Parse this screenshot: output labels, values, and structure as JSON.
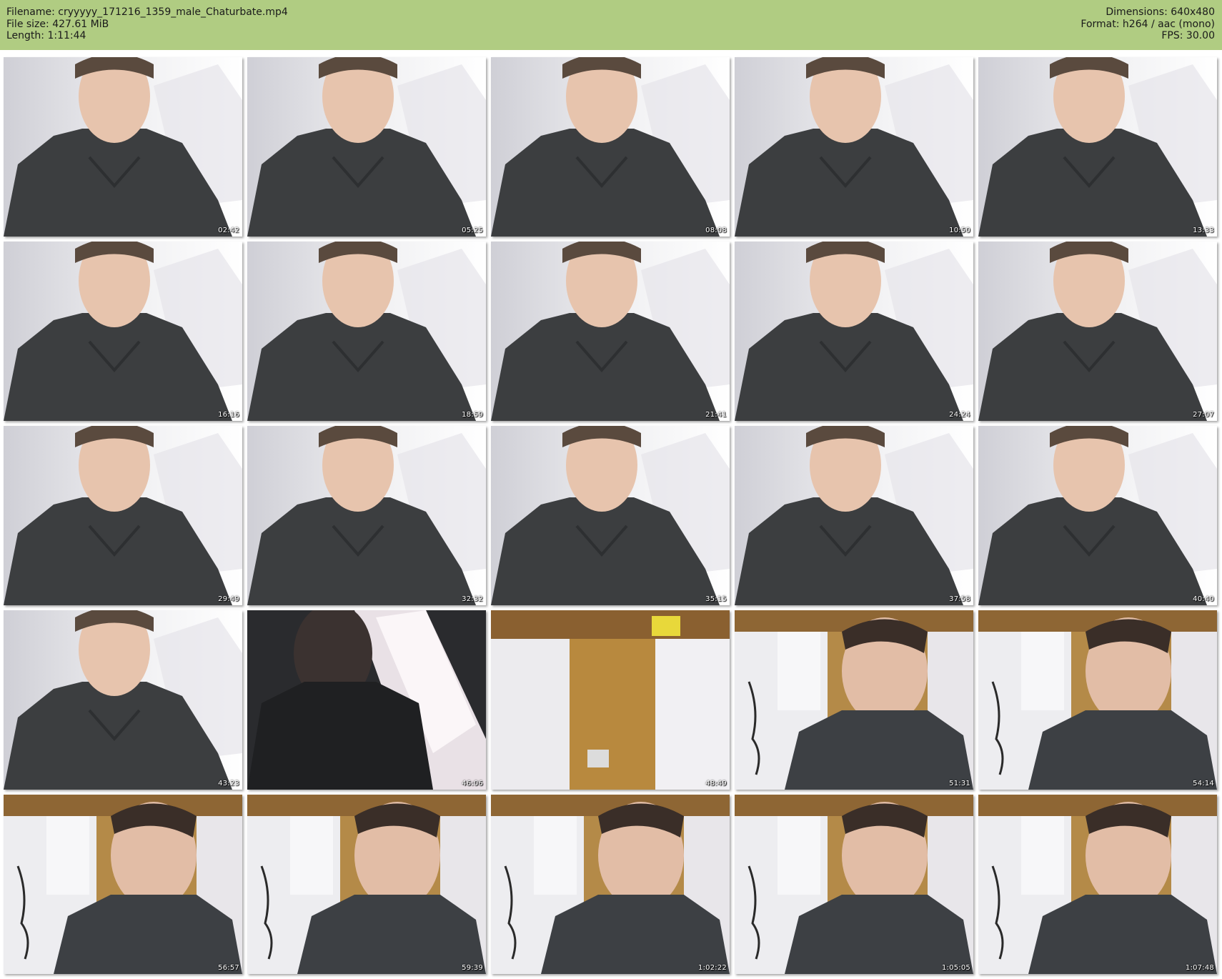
{
  "header": {
    "filename": "Filename: cryyyyy_171216_1359_male_Chaturbate.mp4",
    "filesize": "File size: 427.61 MiB",
    "length": "Length: 1:11:44",
    "dimensions": "Dimensions: 640x480",
    "format": "Format: h264 / aac (mono)",
    "fps": "FPS: 30.00"
  },
  "colors": {
    "header_bg": "#b0cc82",
    "page_bg": "#ffffff",
    "timestamp_text": "#ffffff"
  },
  "thumbnails": [
    {
      "time": "02:42",
      "scene": "bright"
    },
    {
      "time": "05:25",
      "scene": "bright"
    },
    {
      "time": "08:08",
      "scene": "bright"
    },
    {
      "time": "10:50",
      "scene": "bright"
    },
    {
      "time": "13:33",
      "scene": "bright"
    },
    {
      "time": "16:16",
      "scene": "bright"
    },
    {
      "time": "18:59",
      "scene": "bright"
    },
    {
      "time": "21:41",
      "scene": "bright"
    },
    {
      "time": "24:24",
      "scene": "bright"
    },
    {
      "time": "27:07",
      "scene": "bright"
    },
    {
      "time": "29:49",
      "scene": "bright"
    },
    {
      "time": "32:32",
      "scene": "bright"
    },
    {
      "time": "35:15",
      "scene": "bright"
    },
    {
      "time": "37:58",
      "scene": "bright"
    },
    {
      "time": "40:40",
      "scene": "bright"
    },
    {
      "time": "43:23",
      "scene": "bright"
    },
    {
      "time": "46:06",
      "scene": "dark"
    },
    {
      "time": "48:49",
      "scene": "room"
    },
    {
      "time": "51:31",
      "scene": "room-person"
    },
    {
      "time": "54:14",
      "scene": "room-person"
    },
    {
      "time": "56:57",
      "scene": "room-person"
    },
    {
      "time": "59:39",
      "scene": "room-person"
    },
    {
      "time": "1:02:22",
      "scene": "room-person"
    },
    {
      "time": "1:05:05",
      "scene": "room-person"
    },
    {
      "time": "1:07:48",
      "scene": "room-person"
    }
  ]
}
